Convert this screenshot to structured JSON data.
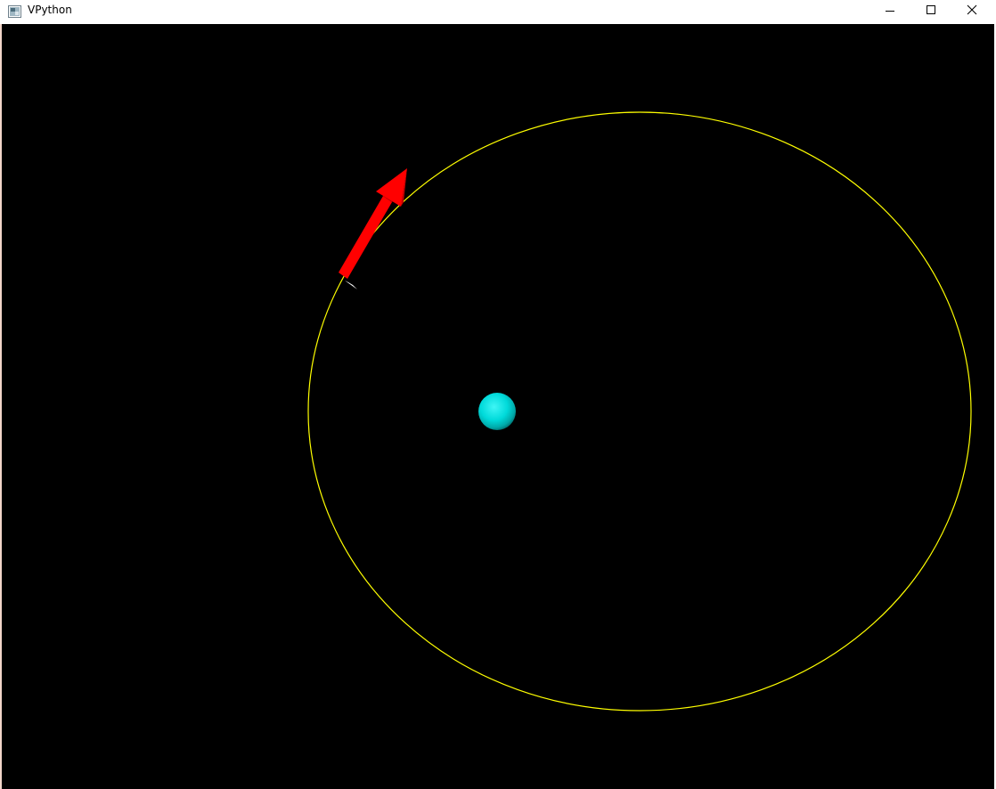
{
  "window": {
    "title": "VPython",
    "controls": {
      "minimize": "minimize-icon",
      "maximize": "maximize-icon",
      "close": "close-icon"
    }
  },
  "scene": {
    "background_color": "#000000",
    "objects": [
      {
        "kind": "orbit-trail",
        "color": "#ffff00"
      },
      {
        "kind": "sphere",
        "color": "#00e5e5"
      },
      {
        "kind": "arrow",
        "color": "#ff0000"
      }
    ]
  }
}
